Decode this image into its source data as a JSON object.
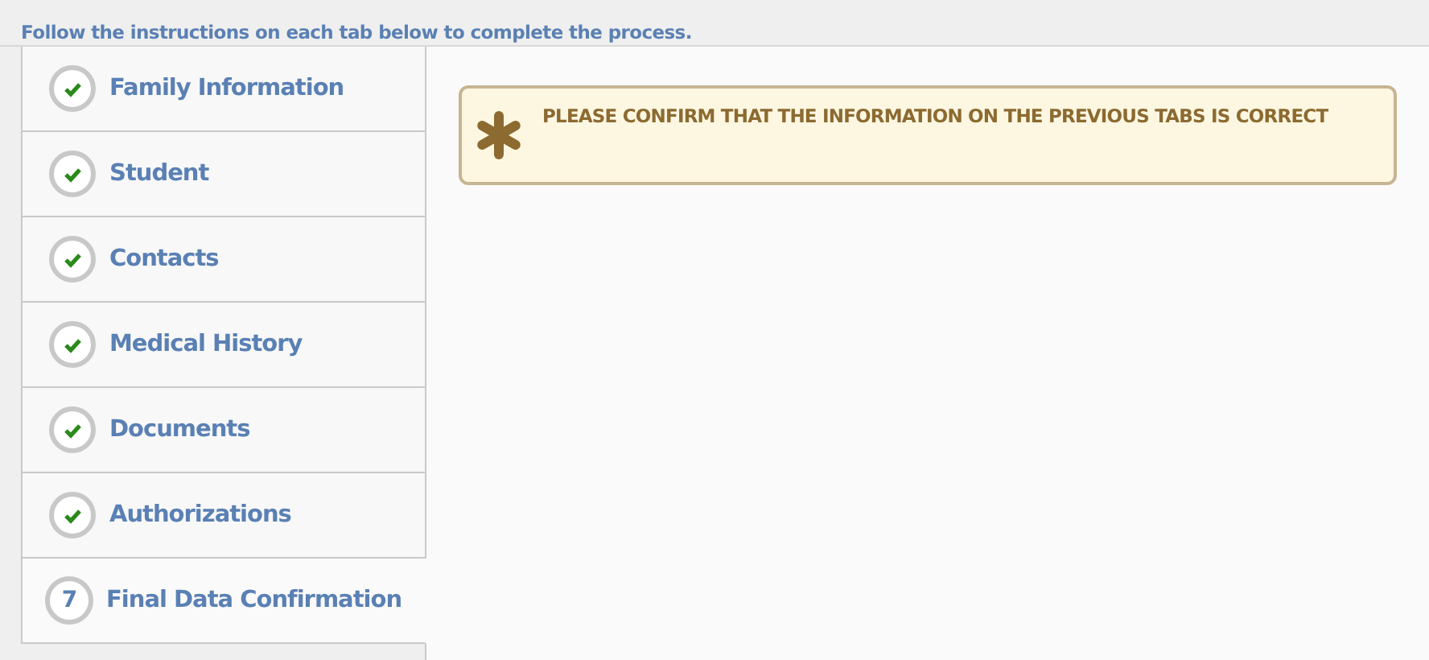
{
  "instructions": "Follow the instructions on each tab below to complete the process.",
  "tabs": [
    {
      "label": "Family Information",
      "completed": true,
      "selected": false
    },
    {
      "label": "Student",
      "completed": true,
      "selected": false
    },
    {
      "label": "Contacts",
      "completed": true,
      "selected": false
    },
    {
      "label": "Medical History",
      "completed": true,
      "selected": false
    },
    {
      "label": "Documents",
      "completed": true,
      "selected": false
    },
    {
      "label": "Authorizations",
      "completed": true,
      "selected": false
    },
    {
      "label": "Final Data Confirmation",
      "completed": false,
      "number": "7",
      "selected": true
    }
  ],
  "alert": {
    "message": "PLEASE CONFIRM THAT THE INFORMATION ON THE PREVIOUS TABS IS CORRECT"
  }
}
